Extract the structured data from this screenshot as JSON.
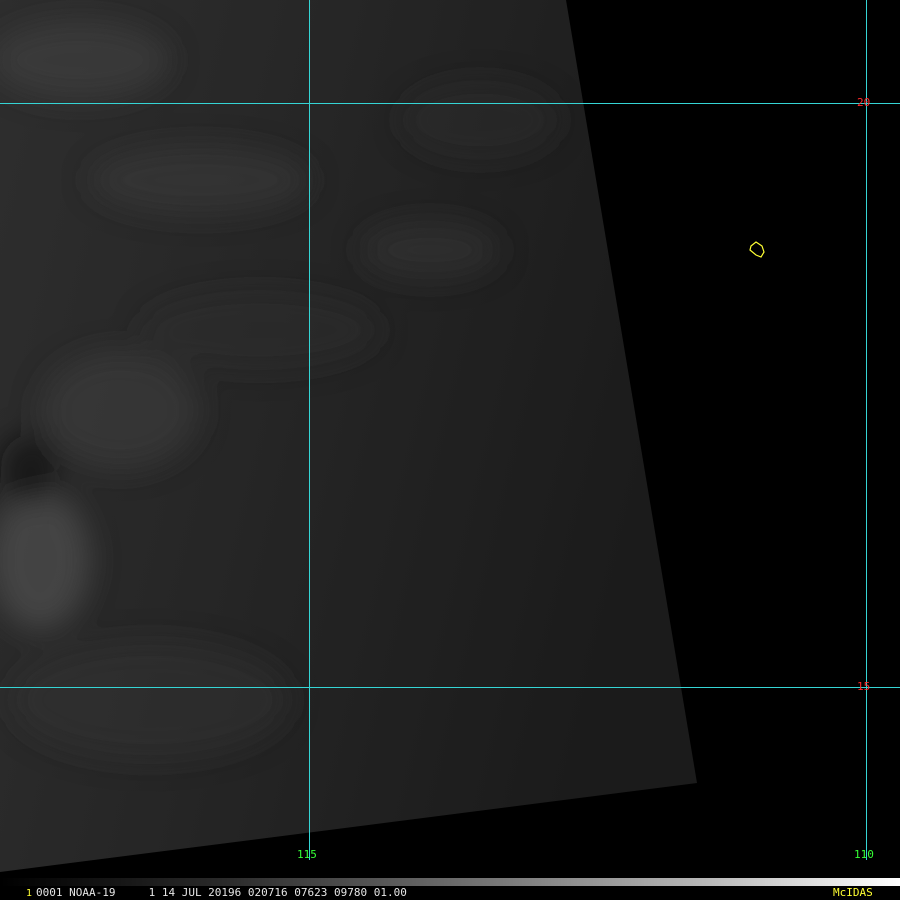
{
  "map": {
    "latitude_labels": [
      "20",
      "15"
    ],
    "longitude_labels": [
      "115",
      "110"
    ],
    "colors": {
      "gridlines": "#35d5d5",
      "latitude_labels": "#ff2a2a",
      "longitude_labels": "#35ff35",
      "coastline": "#ffff33",
      "background": "#000000"
    }
  },
  "status_bar": {
    "frame_number": "1",
    "text": "0001 NOAA-19     1 14 JUL 20196 020716 07623 09780 01.00",
    "brand": "McIDAS"
  }
}
